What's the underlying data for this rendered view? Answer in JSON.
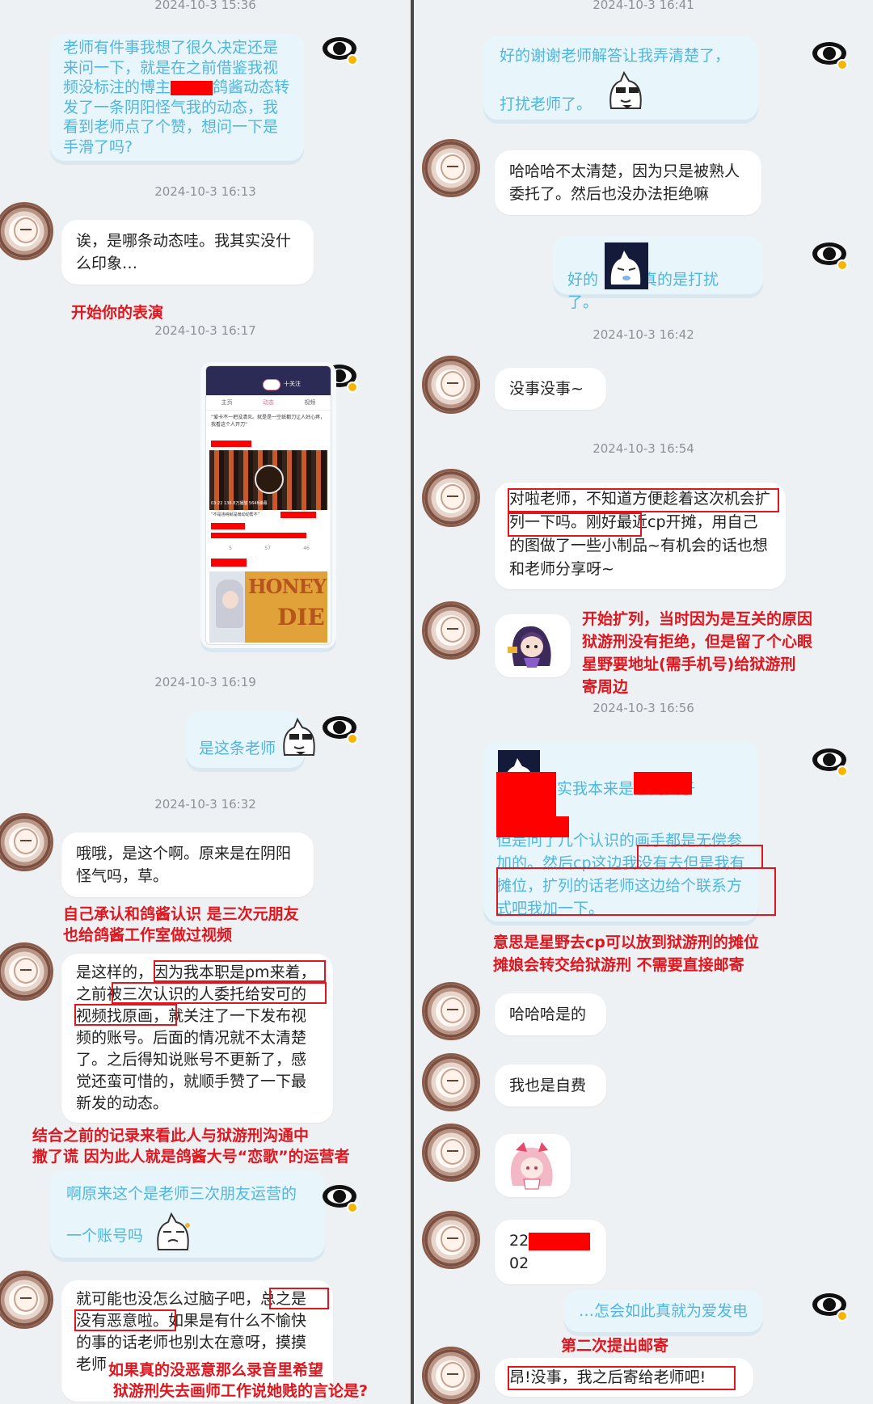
{
  "left": {
    "timestamps": [
      "2024-10-3 15:36",
      "2024-10-3 16:13",
      "2024-10-3 16:17",
      "2024-10-3 16:19",
      "2024-10-3 16:32"
    ],
    "msg1": "老师有件事我想了很久决定还是来问一下，就是在之前借鉴我视频没标注的博主",
    "msg1b": "鸽酱动态转发了一条阴阳怪气我的动态，我看到老师点了个赞，想问一下是手滑了吗?",
    "reply1": "诶，是哪条动态哇。我其实没什么印象…",
    "note1": "开始你的表演",
    "msg_this": "是这条老师",
    "reply2": "哦哦，是这个啊。原来是在阴阳怪气吗，草。",
    "note2a": "自己承认和鸽酱认识  是三次元朋友",
    "note2b": "也给鸽酱工作室做过视频",
    "reply3": "是这样的，因为我本职是pm来着，之前被三次认识的人委托给安可的视频找原画，就关注了一下发布视频的账号。后面的情况就不太清楚了。之后得知说账号不更新了，感觉还蛮可惜的，就顺手赞了一下最新发的动态。",
    "note3a": "结合之前的记录来看此人与狱游刑沟通中",
    "note3b": "撒了谎  因为此人就是鸽酱大号“恋歌”的运营者",
    "msg_friend": "啊原来这个是老师三次朋友运营的",
    "msg_friend2": "一个账号吗",
    "reply4": "就可能也没怎么过脑子吧，总之是没有恶意啦。如果是有什么不愉快的事的话老师也别太在意呀，摸摸老师",
    "note4a": "如果真的没恶意那么录音里希望",
    "note4b": "狱游刑失去画师工作说她贱的言论是?",
    "shot": {
      "tab_badge": "十关注",
      "tabs": [
        "主页",
        "动态",
        "视频"
      ],
      "post_text": "“爱卡不一把没清炎。就是是一空纸都刀让人好心疼，我看这个人开刀”",
      "video_meta": "03:22   136.8万播放   5648弹幕",
      "forward_text": "“不是违纯就是扇动动帮不”",
      "counts": [
        "5",
        "57",
        "46"
      ],
      "honey": "HONEY",
      "die": "DIE"
    }
  },
  "right": {
    "timestamps": [
      "2024-10-3 16:41",
      "2024-10-3 16:42",
      "2024-10-3 16:54",
      "2024-10-3 16:56"
    ],
    "msg1": "好的谢谢老师解答让我弄清楚了，",
    "msg1b": "打扰老师了。",
    "reply1": "哈哈哈不太清楚，因为只是被熟人委托了。然后也没办法拒绝嘛",
    "msg2a": "好的",
    "msg2b": "真的是打扰了。",
    "reply2": "没事没事~",
    "reply3": "对啦老师，不知道方便趁着这次机会扩列一下吗。刚好最近cp开摊，用自己的图做了一些小制品~有机会的话也想和老师分享呀~",
    "note1": [
      "开始扩列，当时因为是互关的原因",
      "狱游刑没有拒绝，但是留了个心眼",
      "星野要地址(需手机号)给狱游刑",
      "寄周边"
    ],
    "msg3a": "其实我本来是想问关于",
    "msg3b": "但是问了几个认识的画手都是无偿参加的。然后cp这边我没有去但是我有摊位，扩列的话老师这边给个联系方式吧我加一下。",
    "note2": [
      "意思是星野去cp可以放到狱游刑的摊位",
      "摊娘会转交给狱游刑  不需要直接邮寄"
    ],
    "reply4": "哈哈哈是的",
    "reply5": "我也是自费",
    "phone_a": "22",
    "phone_b": "02",
    "msg4": "…怎会如此真就为爱发电",
    "note3": "第二次提出邮寄",
    "reply6": "昂!没事，我之后寄给老师吧!"
  },
  "colors": {
    "accent": "#4fb6df",
    "annotation": "#e0161e",
    "redact": "#ff0000"
  }
}
